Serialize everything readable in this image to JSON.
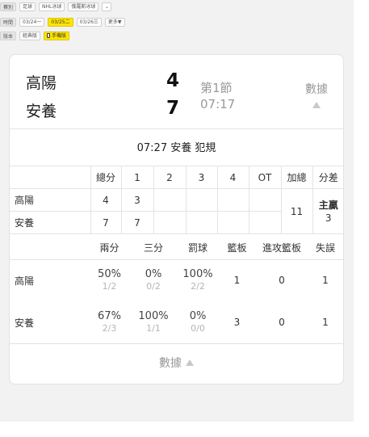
{
  "filters": {
    "league": {
      "label": "賽別",
      "chips": [
        "足球",
        "NHL冰球",
        "俄羅斯冰球"
      ],
      "more": "⌄"
    },
    "time": {
      "label": "時間",
      "chips": [
        "03/24一",
        "03/25二",
        "03/26三",
        "更多▼"
      ],
      "active_index": 1
    },
    "version": {
      "label": "版本",
      "chips": [
        "經典版",
        "手機版"
      ],
      "active_index": 1
    }
  },
  "game": {
    "home": {
      "name": "高陽",
      "score": "4"
    },
    "away": {
      "name": "安養",
      "score": "7"
    },
    "period": "第1節",
    "clock": "07:17",
    "stats_button": "數據",
    "event": "07:27 安養 犯規"
  },
  "quarter_table": {
    "headers": [
      "",
      "總分",
      "1",
      "2",
      "3",
      "4",
      "OT",
      "加總",
      "分差"
    ],
    "rows": [
      {
        "team": "高陽",
        "total": "4",
        "q": [
          "3",
          "",
          "",
          "",
          ""
        ]
      },
      {
        "team": "安養",
        "total": "7",
        "q": [
          "7",
          "",
          "",
          "",
          ""
        ]
      }
    ],
    "sum": "11",
    "diff_label": "主贏",
    "diff_value": "3"
  },
  "stats_table": {
    "headers": [
      "",
      "兩分",
      "三分",
      "罰球",
      "籃板",
      "進攻籃板",
      "失誤"
    ],
    "rows": [
      {
        "team": "高陽",
        "two": {
          "pct": "50%",
          "frac": "1/2"
        },
        "three": {
          "pct": "0%",
          "frac": "0/2"
        },
        "ft": {
          "pct": "100%",
          "frac": "2/2"
        },
        "reb": "1",
        "oreb": "0",
        "to": "1"
      },
      {
        "team": "安養",
        "two": {
          "pct": "67%",
          "frac": "2/3"
        },
        "three": {
          "pct": "100%",
          "frac": "1/1"
        },
        "ft": {
          "pct": "0%",
          "frac": "0/0"
        },
        "reb": "3",
        "oreb": "0",
        "to": "1"
      }
    ]
  },
  "footer_button": "數據"
}
